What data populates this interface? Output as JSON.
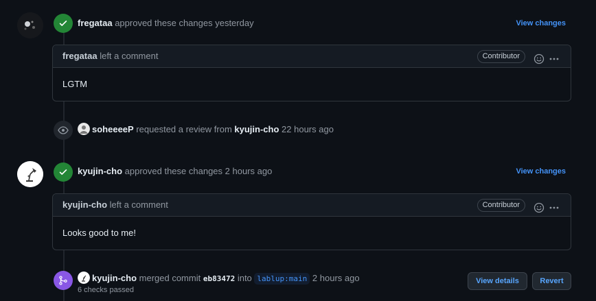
{
  "review1": {
    "author": "fregataa",
    "action": "approved these changes",
    "time": "yesterday",
    "link": "View changes",
    "comment": {
      "author": "fregataa",
      "action": "left a comment",
      "badge": "Contributor",
      "body": "LGTM"
    }
  },
  "request": {
    "author": "soheeeeP",
    "action": "requested a review from",
    "target": "kyujin-cho",
    "time": "22 hours ago"
  },
  "review2": {
    "author": "kyujin-cho",
    "action": "approved these changes",
    "time": "2 hours ago",
    "link": "View changes",
    "comment": {
      "author": "kyujin-cho",
      "action": "left a comment",
      "badge": "Contributor",
      "body": "Looks good to me!"
    }
  },
  "merge": {
    "author": "kyujin-cho",
    "action": "merged commit",
    "sha": "eb83472",
    "into": "into",
    "branch": "lablup:main",
    "time": "2 hours ago",
    "checks": "6 checks passed",
    "view_details": "View details",
    "revert": "Revert"
  },
  "colors": {
    "approve_green": "#238636",
    "merge_purple": "#8957e5",
    "link_blue": "#4493f8"
  }
}
